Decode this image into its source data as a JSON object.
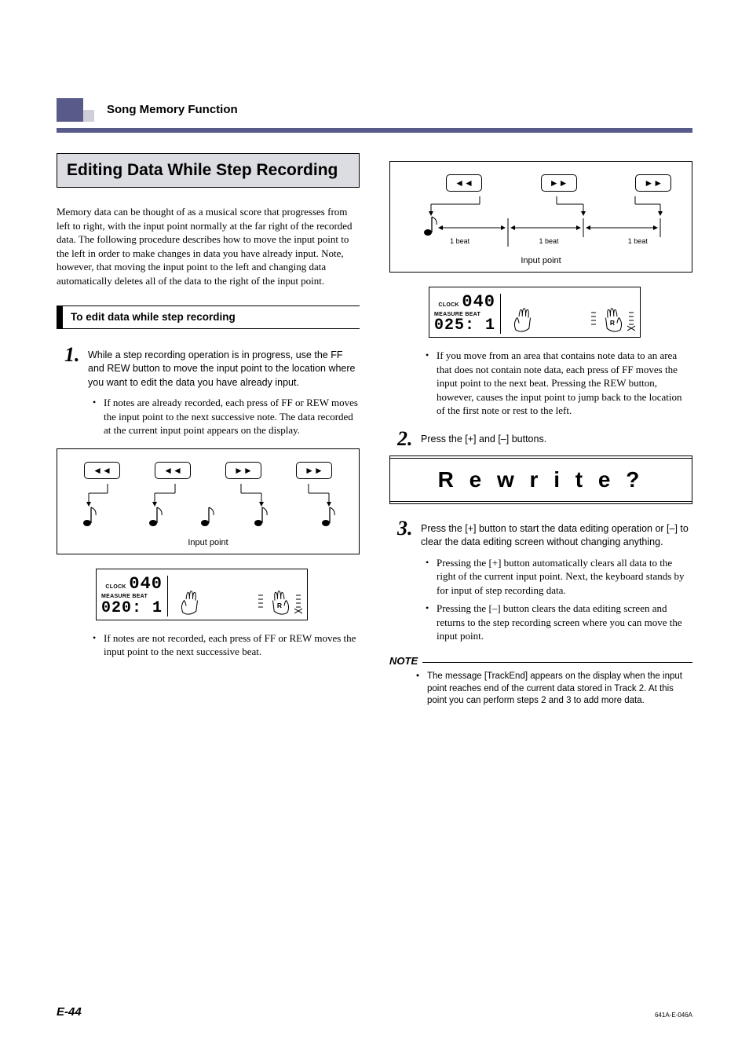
{
  "header": {
    "section": "Song Memory Function"
  },
  "section_title": "Editing Data While Step Recording",
  "intro": "Memory data can be thought of as a musical score that progresses from left to right, with the input point normally at the far right of the recorded data. The following procedure describes how to move the input point to the left in order to make changes in data you have already input. Note, however, that moving the input point to the left and changing data automatically deletes all of the data to the right of the input point.",
  "subhead": "To edit data while step recording",
  "step1": {
    "num": "1.",
    "text": "While a step recording operation is in progress, use the FF and REW button to move the input point to the location where you want to edit the data you have already input.",
    "b1": "If notes are already recorded, each press of FF or REW moves the input point to the next successive note. The data recorded at the current input point appears on the display.",
    "b2": "If notes are not recorded, each press of FF or REW moves the input point to the next successive beat.",
    "b3": "If you move from an area that contains note data to an area that does not contain note data, each press of FF moves the input point to the next beat. Pressing the REW button, however, causes the input point to jump back to the location of the first note or rest to the left."
  },
  "diagram": {
    "input_point": "Input point",
    "beat": "1 beat"
  },
  "lcd1": {
    "clock_label": "CLOCK",
    "clock_val": "040",
    "mb_label": "MEASURE BEAT",
    "mb_val": "020: 1"
  },
  "lcd2": {
    "clock_label": "CLOCK",
    "clock_val": "040",
    "mb_label": "MEASURE BEAT",
    "mb_val": "025: 1"
  },
  "step2": {
    "num": "2.",
    "text": "Press the [+] and [–] buttons."
  },
  "rewrite": "R e w r i t e ?",
  "step3": {
    "num": "3.",
    "text": "Press the [+] button to start the data editing operation or [–] to clear the data editing screen without changing anything.",
    "b1": "Pressing the [+] button automatically clears all data to the right of the current input point. Next, the keyboard stands by for input of step recording data.",
    "b2": "Pressing the [–] button clears the data editing screen and returns to the step recording screen where you can move the input point."
  },
  "note": {
    "label": "NOTE",
    "item": "The message [TrackEnd] appears on the display when the input point reaches end of the current data stored in Track 2. At this point you can perform steps 2 and 3 to add more data."
  },
  "footer": {
    "page": "E-44",
    "code": "641A-E-046A"
  }
}
